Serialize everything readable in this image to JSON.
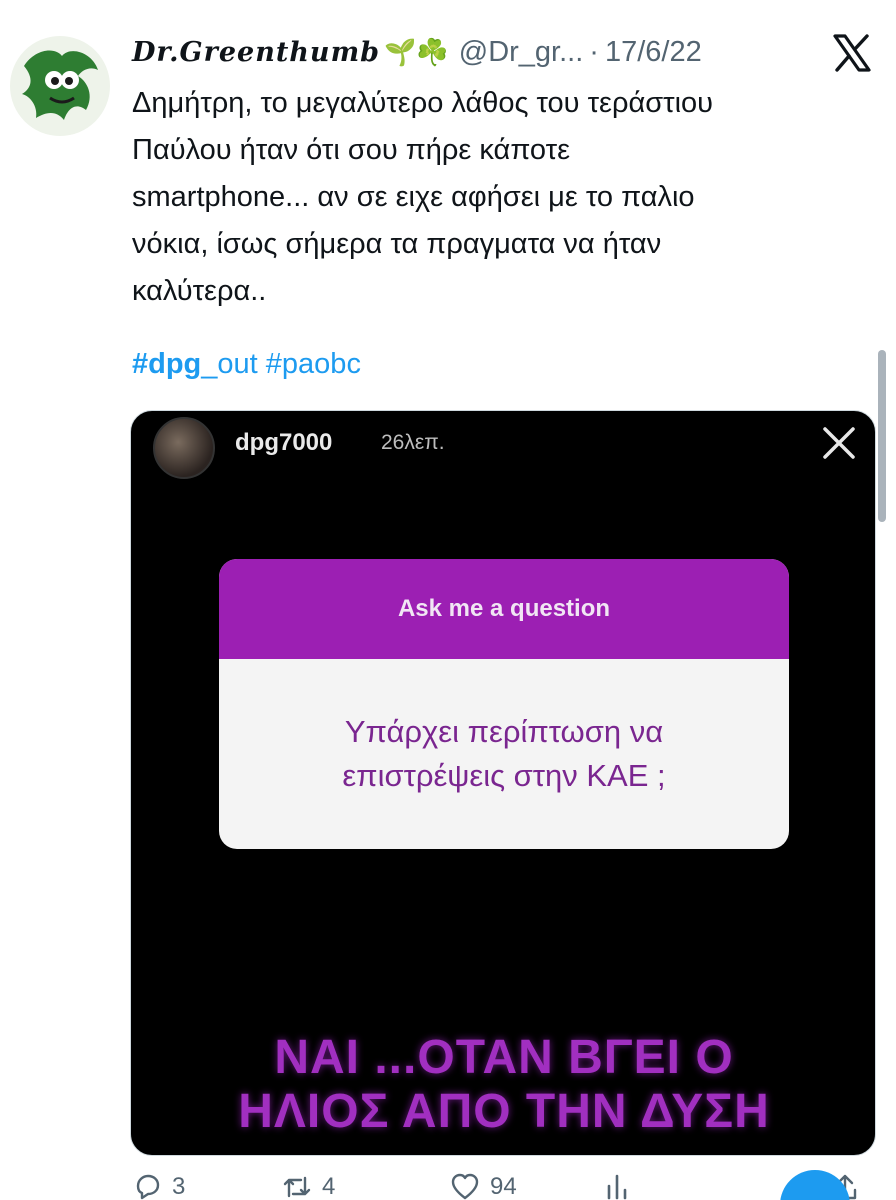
{
  "tweet": {
    "author_name": "Dr.Greenthumb",
    "name_emojis": "🌱☘️",
    "handle": "@Dr_gr...",
    "separator": "·",
    "date": "17/6/22",
    "text_lines": [
      "Δημήτρη, το μεγαλύτερο λάθος του τεράστιου",
      "Παύλου ήταν ότι σου πήρε κάποτε",
      "smartphone... αν σε ειχε αφήσει με το παλιο",
      "νόκια, ίσως σήμερα τα πραγματα να ήταν",
      "καλύτερα.."
    ],
    "hashtags": {
      "tag1_bold": "#dpg",
      "tag1_rest": "_out",
      "tag2": "#paobc"
    },
    "metrics": {
      "replies": "3",
      "retweets": "4",
      "likes": "94"
    }
  },
  "media": {
    "story_username": "dpg7000",
    "story_time": "26λεπ.",
    "question_header": "Ask me a question",
    "question_lines": [
      "Υπάρχει περίπτωση να",
      "επιστρέψεις στην ΚΑΕ ;"
    ],
    "answer_lines": [
      "ΝΑΙ ...ΟΤΑΝ ΒΓΕΙ Ο",
      "ΗΛΙΟΣ ΑΠΟ ΤΗΝ ΔΥΣΗ"
    ]
  },
  "icons": {
    "platform": "x-logo-icon",
    "reply": "reply-icon",
    "retweet": "retweet-icon",
    "like": "heart-icon",
    "views": "views-icon",
    "share": "share-icon",
    "close": "close-icon"
  },
  "colors": {
    "link": "#1d9bf0",
    "question_header": "#9c1fb3",
    "answer_text": "#a12fc0"
  }
}
